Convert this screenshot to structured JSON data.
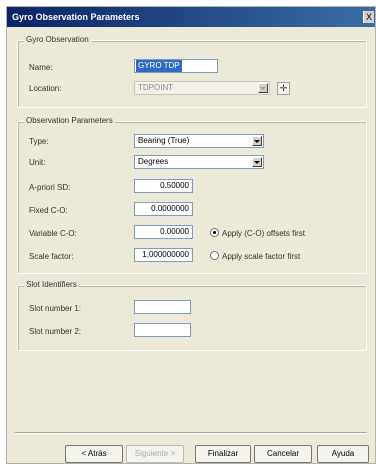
{
  "window": {
    "title": "Gyro Observation Parameters",
    "close_glyph": "X"
  },
  "gyro_observation": {
    "legend": "Gyro Observation",
    "name_label": "Name:",
    "name_value": "GYRO TDP",
    "location_label": "Location:",
    "location_value": "TDPOINT",
    "pick_icon": "crosshair-icon",
    "pick_glyph": "✛"
  },
  "observation_parameters": {
    "legend": "Observation Parameters",
    "type_label": "Type:",
    "type_value": "Bearing (True)",
    "unit_label": "Unit:",
    "unit_value": "Degrees",
    "apriori_label": "A-priori SD:",
    "apriori_value": "0.50000",
    "fixed_label": "Fixed C-O:",
    "fixed_value": "0.0000000",
    "variable_label": "Variable C-O:",
    "variable_value": "0.00000",
    "scale_label": "Scale factor:",
    "scale_value": "1.000000000",
    "radio_apply_co": "Apply (C-O) offsets first",
    "radio_apply_co_selected": true,
    "radio_apply_scale": "Apply scale factor first",
    "radio_apply_scale_selected": false
  },
  "slot_identifiers": {
    "legend": "Slot Identifiers",
    "slot1_label": "Slot number 1:",
    "slot1_value": "",
    "slot2_label": "Slot number 2:",
    "slot2_value": ""
  },
  "buttons": {
    "back": "< Atrás",
    "next": "Siguiente >",
    "finish": "Finalizar",
    "cancel": "Cancelar",
    "help": "Ayuda"
  }
}
